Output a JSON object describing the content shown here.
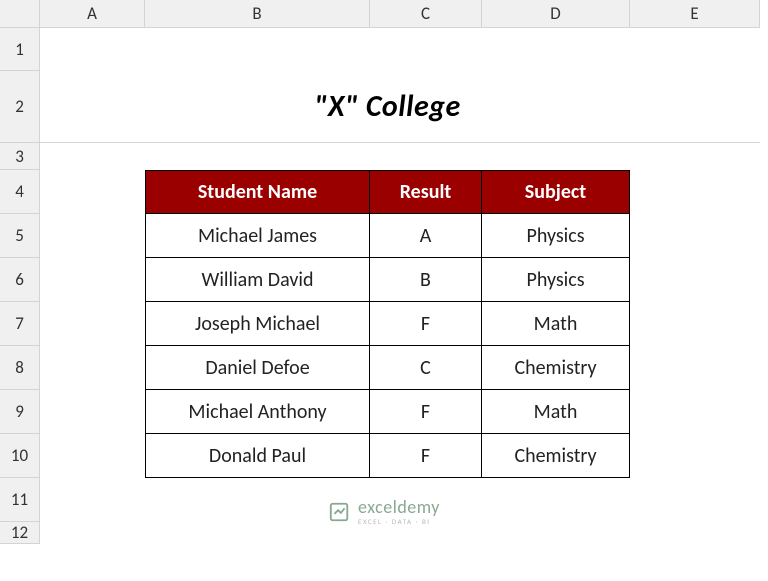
{
  "columns": [
    "A",
    "B",
    "C",
    "D",
    "E"
  ],
  "rows": [
    "1",
    "2",
    "3",
    "4",
    "5",
    "6",
    "7",
    "8",
    "9",
    "10",
    "11",
    "12"
  ],
  "title": "\"X\" College",
  "table": {
    "headers": [
      "Student Name",
      "Result",
      "Subject"
    ],
    "rows": [
      {
        "name": "Michael James",
        "result": "A",
        "subject": "Physics"
      },
      {
        "name": "William David",
        "result": "B",
        "subject": "Physics"
      },
      {
        "name": "Joseph Michael",
        "result": "F",
        "subject": "Math"
      },
      {
        "name": "Daniel Defoe",
        "result": "C",
        "subject": "Chemistry"
      },
      {
        "name": "Michael Anthony",
        "result": "F",
        "subject": "Math"
      },
      {
        "name": "Donald Paul",
        "result": "F",
        "subject": "Chemistry"
      }
    ]
  },
  "watermark": {
    "brand": "exceldemy",
    "tagline": "EXCEL · DATA · BI"
  }
}
